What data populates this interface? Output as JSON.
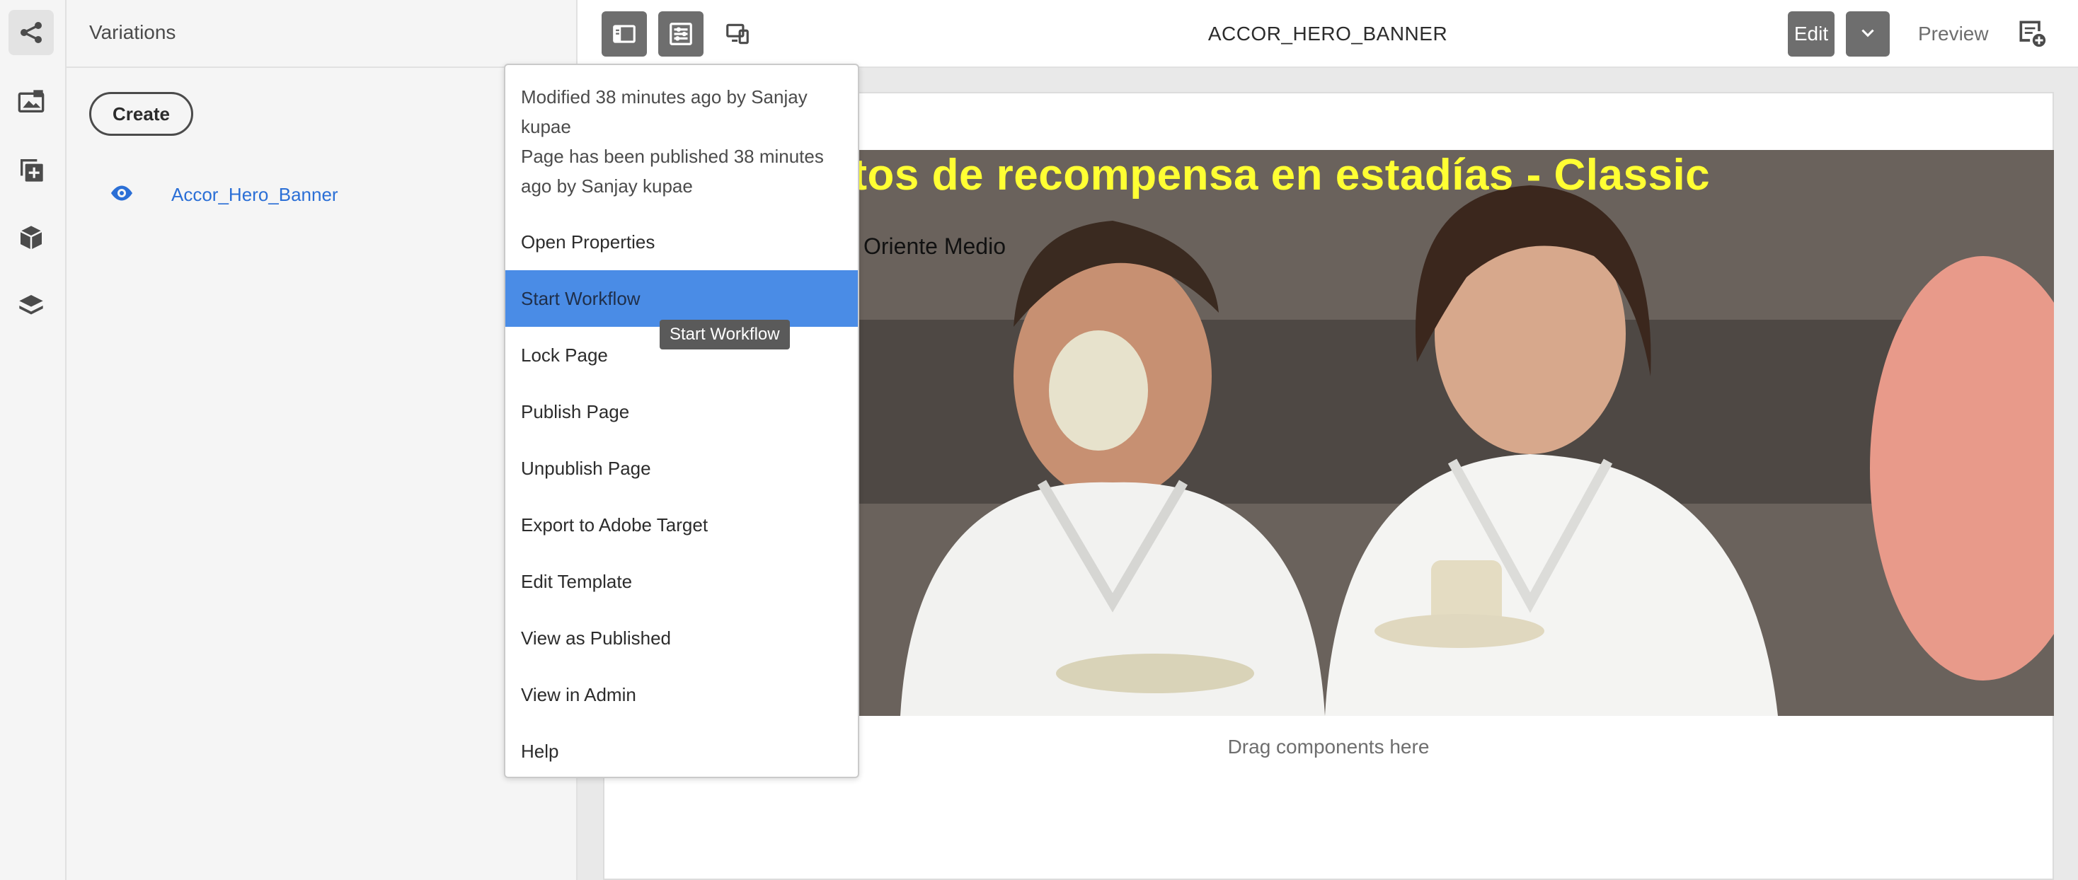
{
  "rail": {
    "items": [
      {
        "icon": "share-graph-icon",
        "active": true
      },
      {
        "icon": "asset-gallery-icon",
        "active": false
      },
      {
        "icon": "add-component-icon",
        "active": false
      },
      {
        "icon": "box-icon",
        "active": false
      },
      {
        "icon": "layers-icon",
        "active": false
      }
    ]
  },
  "panel": {
    "title": "Variations",
    "create_label": "Create",
    "variation_name": "Accor_Hero_Banner"
  },
  "topbar": {
    "title": "ACCOR_HERO_BANNER",
    "edit_label": "Edit",
    "preview_label": "Preview"
  },
  "hero": {
    "headline": "ntos de recompensa en estadías - Classic",
    "subtext": "Oriente Medio"
  },
  "canvas": {
    "drag_placeholder": "Drag components here"
  },
  "menu": {
    "info_modified": "Modified 38 minutes ago by Sanjay kupae",
    "info_published": "Page has been published 38 minutes ago by Sanjay kupae",
    "items": [
      "Open Properties",
      "Start Workflow",
      "Lock Page",
      "Publish Page",
      "Unpublish Page",
      "Export to Adobe Target",
      "Edit Template",
      "View as Published",
      "View in Admin",
      "Help"
    ],
    "highlighted": "Start Workflow",
    "tooltip": "Start Workflow"
  },
  "colors": {
    "accent_blue": "#2b6fd6",
    "highlight": "#4a8ce6",
    "headline_yellow": "#ffff33"
  }
}
